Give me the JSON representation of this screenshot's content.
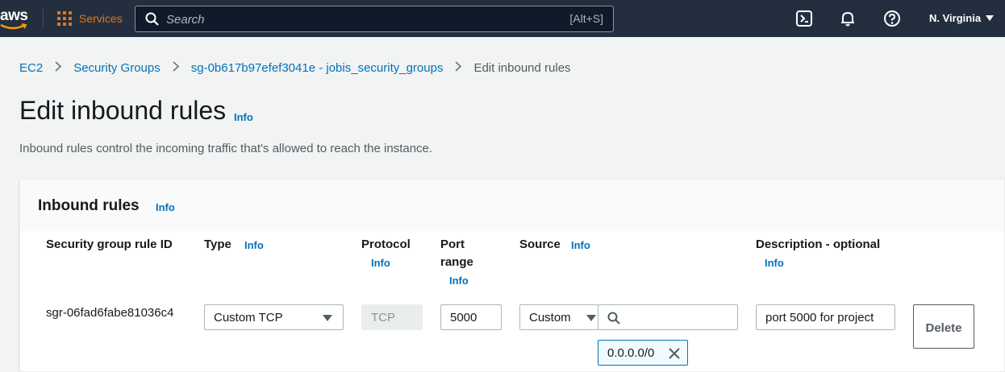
{
  "topbar": {
    "logo_text": "aws",
    "services_label": "Services",
    "search_placeholder": "Search",
    "search_shortcut": "[Alt+S]",
    "region": "N. Virginia",
    "icons": [
      "grid-icon",
      "search-icon",
      "cloudshell-icon",
      "bell-icon",
      "help-icon",
      "caret-down-icon"
    ]
  },
  "breadcrumb": [
    "EC2",
    "Security Groups",
    "sg-0b617b97efef3041e - jobis_security_groups",
    "Edit inbound rules"
  ],
  "page": {
    "title": "Edit inbound rules",
    "title_info": "Info",
    "description": "Inbound rules control the incoming traffic that's allowed to reach the instance."
  },
  "panel": {
    "title": "Inbound rules",
    "info": "Info",
    "columns": {
      "rule_id": "Security group rule ID",
      "type": "Type",
      "type_info": "Info",
      "protocol": "Protocol",
      "protocol_info": "Info",
      "port_range_1": "Port",
      "port_range_2": "range",
      "port_info": "Info",
      "source": "Source",
      "source_info": "Info",
      "description": "Description - optional",
      "description_info": "Info"
    },
    "row": {
      "rule_id": "sgr-06fad6fabe81036c4",
      "type": "Custom TCP",
      "protocol": "TCP",
      "port_range": "5000",
      "source_type": "Custom",
      "source_search": "",
      "source_token": "0.0.0.0/0",
      "description": "port 5000 for project",
      "delete_label": "Delete"
    }
  },
  "colors": {
    "topbar": "#232f3e",
    "accent_orange": "#ec7211",
    "link_blue": "#0073bb",
    "background": "#f2f3f3"
  }
}
